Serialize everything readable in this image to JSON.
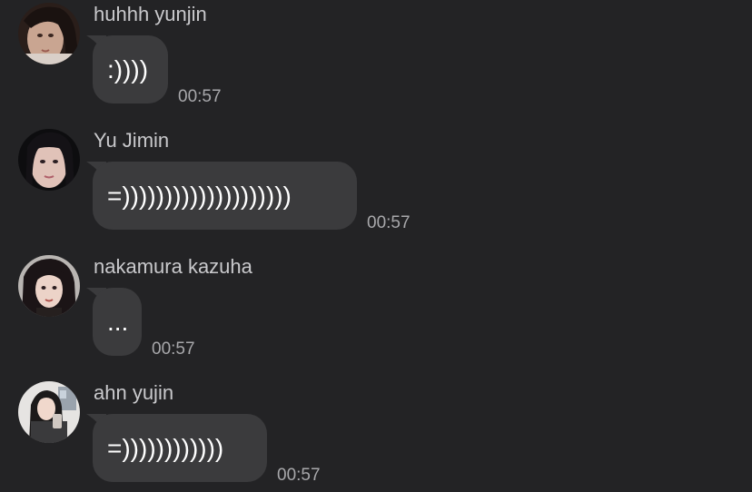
{
  "messages": [
    {
      "sender": "huhhh yunjin",
      "text": ":))))",
      "time": "00:57"
    },
    {
      "sender": "Yu Jimin",
      "text": "=))))))))))))))))))))",
      "time": "00:57"
    },
    {
      "sender": "nakamura kazuha",
      "text": "...",
      "time": "00:57"
    },
    {
      "sender": "ahn yujin",
      "text": "=))))))))))))",
      "time": "00:57"
    }
  ],
  "colors": {
    "background": "#232325",
    "bubble": "#3b3b3d",
    "sender_text": "#c9c9cc",
    "message_text": "#ffffff",
    "timestamp": "#a8a8ab"
  }
}
